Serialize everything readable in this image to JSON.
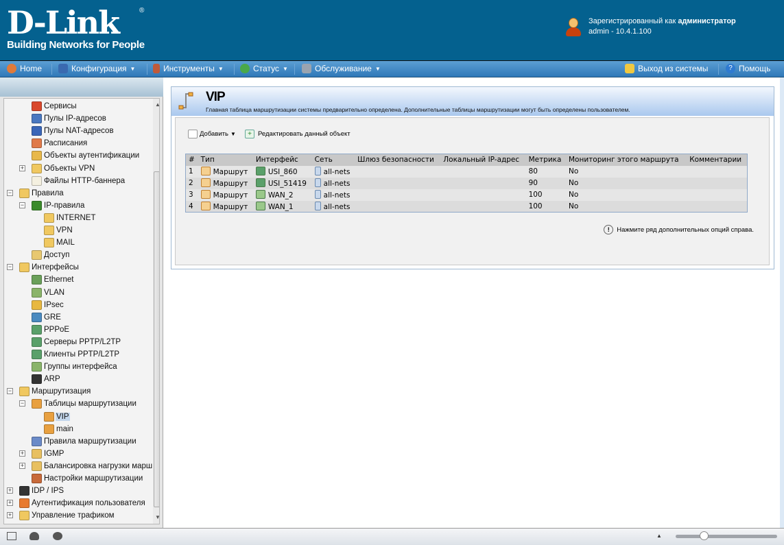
{
  "header": {
    "brand": "D-Link",
    "tagline": "Building Networks for People",
    "registered_prefix": "Зарегистрированный как ",
    "registered_role": "администратор",
    "user_line": "admin - 10.4.1.100"
  },
  "nav": {
    "home": "Home",
    "config": "Конфигурация",
    "tools": "Инструменты",
    "status": "Статус",
    "maintenance": "Обслуживание",
    "logout": "Выход из системы",
    "help": "Помощь"
  },
  "tree": [
    {
      "label": "Сервисы",
      "level": 2,
      "color": "#d9482c"
    },
    {
      "label": "Пулы IP-адресов",
      "level": 2,
      "color": "#4a78c0"
    },
    {
      "label": "Пулы NAT-адресов",
      "level": 2,
      "color": "#3a66b8"
    },
    {
      "label": "Расписания",
      "level": 2,
      "color": "#e07a4a"
    },
    {
      "label": "Объекты аутентификации",
      "level": 2,
      "color": "#e8b84a"
    },
    {
      "label": "Объекты VPN",
      "level": 2,
      "color": "#f0c860",
      "toggle": "+"
    },
    {
      "label": "Файлы HTTP-баннера",
      "level": 2,
      "color": "#f4f0e0"
    },
    {
      "label": "Правила",
      "level": 1,
      "color": "#f0c860",
      "toggle": "-"
    },
    {
      "label": "IP-правила",
      "level": 2,
      "color": "#3a8a2a",
      "toggle": "-"
    },
    {
      "label": "INTERNET",
      "level": 3,
      "color": "#f0c860"
    },
    {
      "label": "VPN",
      "level": 3,
      "color": "#f0c860"
    },
    {
      "label": "MAIL",
      "level": 3,
      "color": "#f0c860"
    },
    {
      "label": "Доступ",
      "level": 2,
      "color": "#e8c870"
    },
    {
      "label": "Интерфейсы",
      "level": 1,
      "color": "#f0c860",
      "toggle": "-"
    },
    {
      "label": "Ethernet",
      "level": 2,
      "color": "#6aa05a"
    },
    {
      "label": "VLAN",
      "level": 2,
      "color": "#8ab46a"
    },
    {
      "label": "IPsec",
      "level": 2,
      "color": "#e8b840"
    },
    {
      "label": "GRE",
      "level": 2,
      "color": "#4a8ac0"
    },
    {
      "label": "PPPoE",
      "level": 2,
      "color": "#5aa06a"
    },
    {
      "label": "Серверы PPTP/L2TP",
      "level": 2,
      "color": "#5aa06a"
    },
    {
      "label": "Клиенты PPTP/L2TP",
      "level": 2,
      "color": "#5aa06a"
    },
    {
      "label": "Группы интерфейса",
      "level": 2,
      "color": "#8ab46a"
    },
    {
      "label": "ARP",
      "level": 2,
      "color": "#333333"
    },
    {
      "label": "Маршрутизация",
      "level": 1,
      "color": "#f0c860",
      "toggle": "-"
    },
    {
      "label": "Таблицы маршрутизации",
      "level": 2,
      "color": "#e8a040",
      "toggle": "-"
    },
    {
      "label": "VIP",
      "level": 3,
      "color": "#e8a040",
      "selected": true
    },
    {
      "label": "main",
      "level": 3,
      "color": "#e8a040"
    },
    {
      "label": "Правила маршрутизации",
      "level": 2,
      "color": "#6a8ac8"
    },
    {
      "label": "IGMP",
      "level": 2,
      "color": "#e8c060",
      "toggle": "+"
    },
    {
      "label": "Балансировка нагрузки марш",
      "level": 2,
      "color": "#e8c060",
      "toggle": "+"
    },
    {
      "label": "Настройки маршрутизации",
      "level": 2,
      "color": "#c86a3a"
    },
    {
      "label": "IDP / IPS",
      "level": 1,
      "color": "#333333",
      "toggle": "+"
    },
    {
      "label": "Аутентификация пользователя",
      "level": 1,
      "color": "#e87a30",
      "toggle": "+"
    },
    {
      "label": "Управление трафиком",
      "level": 1,
      "color": "#f0c860",
      "toggle": "+"
    }
  ],
  "panel": {
    "title": "VIP",
    "description": "Главная таблица маршрутизации системы предварительно определена. Дополнительные таблицы маршрутизации могут быть определены пользователем.",
    "add": "Добавить",
    "edit": "Редактировать данный объект",
    "hint": "Нажмите ряд дополнительных опций справа."
  },
  "table": {
    "columns": [
      "#",
      "Тип",
      "Интерфейс",
      "Сеть",
      "Шлюз безопасности",
      "Локальный IP-адрес",
      "Метрика",
      "Мониторинг этого маршрута",
      "Комментарии"
    ],
    "rows": [
      {
        "n": "1",
        "type": "Маршрут",
        "iface": "USI_860",
        "net": "all-nets",
        "gw": "",
        "local": "",
        "metric": "80",
        "monitor": "No",
        "comment": ""
      },
      {
        "n": "2",
        "type": "Маршрут",
        "iface": "USI_51419",
        "net": "all-nets",
        "gw": "",
        "local": "",
        "metric": "90",
        "monitor": "No",
        "comment": ""
      },
      {
        "n": "3",
        "type": "Маршрут",
        "iface": "WAN_2",
        "net": "all-nets",
        "gw": "",
        "local": "",
        "metric": "100",
        "monitor": "No",
        "comment": ""
      },
      {
        "n": "4",
        "type": "Маршрут",
        "iface": "WAN_1",
        "net": "all-nets",
        "gw": "",
        "local": "",
        "metric": "100",
        "monitor": "No",
        "comment": ""
      }
    ]
  },
  "statusbar": {
    "zoom_fraction": 0.28
  }
}
